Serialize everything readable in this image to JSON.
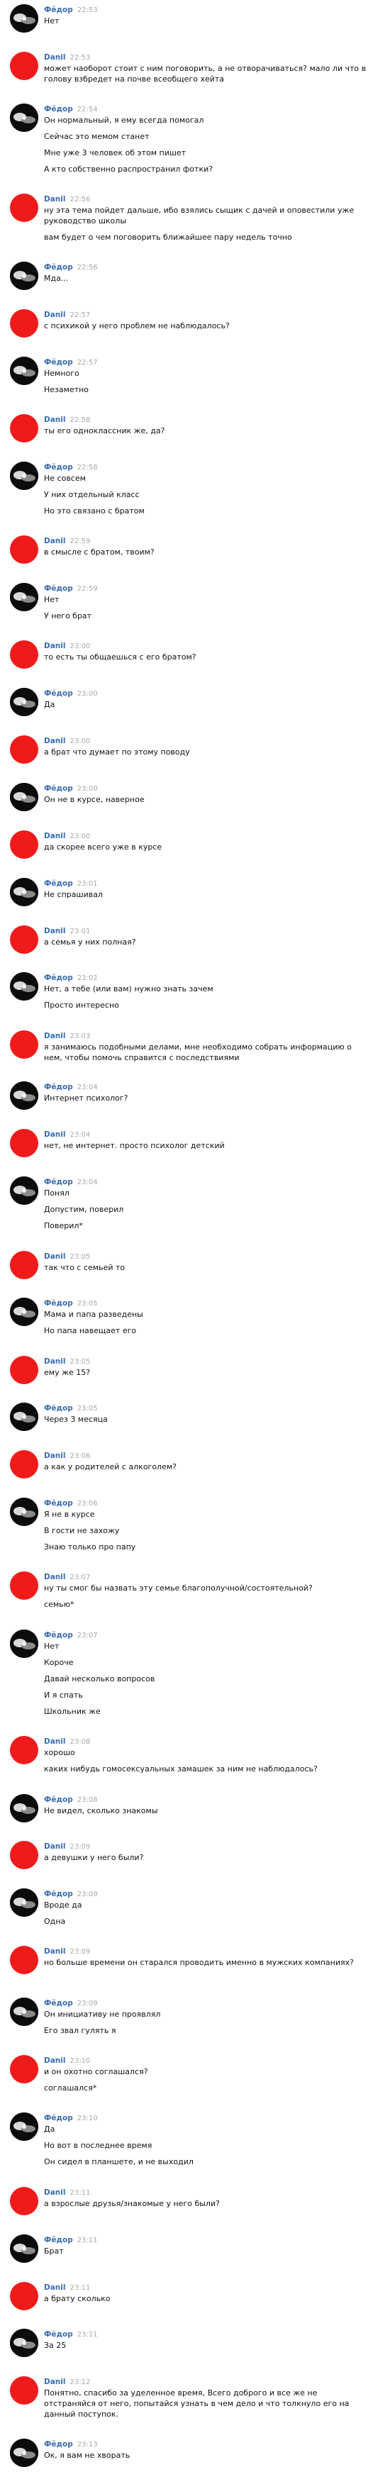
{
  "messages": [
    {
      "author": "Фёдор",
      "time": "22:53",
      "lines": [
        "Нет"
      ]
    },
    {
      "author": "Danil",
      "time": "22:53",
      "lines": [
        "может наоборот стоит с ним поговорить, а не отворачиваться? мало ли что в голову взбредет на почве всеобщего хейта"
      ]
    },
    {
      "author": "Фёдор",
      "time": "22:54",
      "lines": [
        "Он нормальный, я ему всегда помогал",
        "",
        "Сейчас это мемом станет",
        "",
        "Мне уже 3 человек об этом пишет",
        "",
        "А кто собственно распространил фотки?"
      ]
    },
    {
      "author": "Danil",
      "time": "22:56",
      "lines": [
        "ну эта тема пойдет дальше, ибо взялись сыщик с дачей и оповестили уже руководство школы",
        "",
        "вам будет о чем поговорить ближайшее пару недель точно"
      ]
    },
    {
      "author": "Фёдор",
      "time": "22:56",
      "lines": [
        "Мда..."
      ]
    },
    {
      "author": "Danil",
      "time": "22:57",
      "lines": [
        "с психикой у него проблем не наблюдалось?"
      ]
    },
    {
      "author": "Фёдор",
      "time": "22:57",
      "lines": [
        "Немного",
        "",
        "Незаметно"
      ]
    },
    {
      "author": "Danil",
      "time": "22:58",
      "lines": [
        "ты его одноклассник же, да?"
      ]
    },
    {
      "author": "Фёдор",
      "time": "22:58",
      "lines": [
        "Не совсем",
        "",
        "У них отдельный класс",
        "",
        "Но это связано с братом"
      ]
    },
    {
      "author": "Danil",
      "time": "22:59",
      "lines": [
        "в смысле с братом, твоим?"
      ]
    },
    {
      "author": "Фёдор",
      "time": "22:59",
      "lines": [
        "Нет",
        "",
        "У него брат"
      ]
    },
    {
      "author": "Danil",
      "time": "23:00",
      "lines": [
        "то есть ты общаешься с его братом?"
      ]
    },
    {
      "author": "Фёдор",
      "time": "23:00",
      "lines": [
        "Да"
      ]
    },
    {
      "author": "Danil",
      "time": "23:00",
      "lines": [
        "а брат что думает по этому поводу"
      ]
    },
    {
      "author": "Фёдор",
      "time": "23:00",
      "lines": [
        "Он не в курсе, наверное"
      ]
    },
    {
      "author": "Danil",
      "time": "23:00",
      "lines": [
        "да скорее всего уже в курсе"
      ]
    },
    {
      "author": "Фёдор",
      "time": "23:01",
      "lines": [
        "Не спрашивал"
      ]
    },
    {
      "author": "Danil",
      "time": "23:01",
      "lines": [
        "а семья у них полная?"
      ]
    },
    {
      "author": "Фёдор",
      "time": "23:02",
      "lines": [
        "Нет, а тебе (или вам) нужно знать зачем",
        "",
        "Просто интересно"
      ]
    },
    {
      "author": "Danil",
      "time": "23:03",
      "lines": [
        "я занимаюсь подобными делами, мне необходимо собрать информацию о нем, чтобы помочь справится с последствиями"
      ]
    },
    {
      "author": "Фёдор",
      "time": "23:04",
      "lines": [
        "Интернет психолог?"
      ]
    },
    {
      "author": "Danil",
      "time": "23:04",
      "lines": [
        "нет, не интернет. просто психолог детский"
      ]
    },
    {
      "author": "Фёдор",
      "time": "23:04",
      "lines": [
        "Понял",
        "",
        "Допустим, поверил",
        "",
        "Поверил*"
      ]
    },
    {
      "author": "Danil",
      "time": "23:05",
      "lines": [
        "так что с семьей то"
      ]
    },
    {
      "author": "Фёдор",
      "time": "23:05",
      "lines": [
        "Мама и папа разведены",
        "",
        "Но папа навещает его"
      ]
    },
    {
      "author": "Danil",
      "time": "23:05",
      "lines": [
        "ему же 15?"
      ]
    },
    {
      "author": "Фёдор",
      "time": "23:05",
      "lines": [
        "Через 3 месяца"
      ]
    },
    {
      "author": "Danil",
      "time": "23:06",
      "lines": [
        "а как у родителей с алкоголем?"
      ]
    },
    {
      "author": "Фёдор",
      "time": "23:06",
      "lines": [
        "Я не в курсе",
        "",
        "В гости не захожу",
        "",
        "Знаю только про папу"
      ]
    },
    {
      "author": "Danil",
      "time": "23:07",
      "lines": [
        "ну ты смог бы назвать эту семье благополучной/состоятельной?",
        "",
        "семью*"
      ]
    },
    {
      "author": "Фёдор",
      "time": "23:07",
      "lines": [
        "Нет",
        "",
        "Короче",
        "",
        "Давай несколько вопросов",
        "",
        "И я спать",
        "",
        "Школьник же"
      ]
    },
    {
      "author": "Danil",
      "time": "23:08",
      "lines": [
        "хорошо",
        "",
        "каких нибудь гомосексуальных замашек за ним не наблюдалось?"
      ]
    },
    {
      "author": "Фёдор",
      "time": "23:08",
      "lines": [
        "Не видел, сколько знакомы"
      ]
    },
    {
      "author": "Danil",
      "time": "23:09",
      "lines": [
        "а девушки у него были?"
      ]
    },
    {
      "author": "Фёдор",
      "time": "23:09",
      "lines": [
        "Вроде да",
        "",
        "Одна"
      ]
    },
    {
      "author": "Danil",
      "time": "23:09",
      "lines": [
        "но больше времени он старался проводить именно в мужских компаниях?"
      ]
    },
    {
      "author": "Фёдор",
      "time": "23:09",
      "lines": [
        "Он инициативу не проявлял",
        "",
        "Его звал гулять я"
      ]
    },
    {
      "author": "Danil",
      "time": "23:10",
      "lines": [
        "и он охотно соглашался?",
        "",
        "соглашался*"
      ]
    },
    {
      "author": "Фёдор",
      "time": "23:10",
      "lines": [
        "Да",
        "",
        "Но вот в последнее время",
        "",
        "Он сидел в планшете, и не выходил"
      ]
    },
    {
      "author": "Danil",
      "time": "23:11",
      "lines": [
        "а взрослые друзья/знакомые у него были?"
      ]
    },
    {
      "author": "Фёдор",
      "time": "23:11",
      "lines": [
        "Брат"
      ]
    },
    {
      "author": "Danil",
      "time": "23:11",
      "lines": [
        "а брату сколько"
      ]
    },
    {
      "author": "Фёдор",
      "time": "23:11",
      "lines": [
        "За 25"
      ]
    },
    {
      "author": "Danil",
      "time": "23:12",
      "lines": [
        "Понятно, спасибо за уделенное время, Всего доброго и все же не отстраняйся от него, попытайся узнать в чем дело и что толкнуло его на данный поступок."
      ]
    },
    {
      "author": "Фёдор",
      "time": "23:13",
      "lines": [
        "Ок, я вам не хворать"
      ]
    }
  ]
}
